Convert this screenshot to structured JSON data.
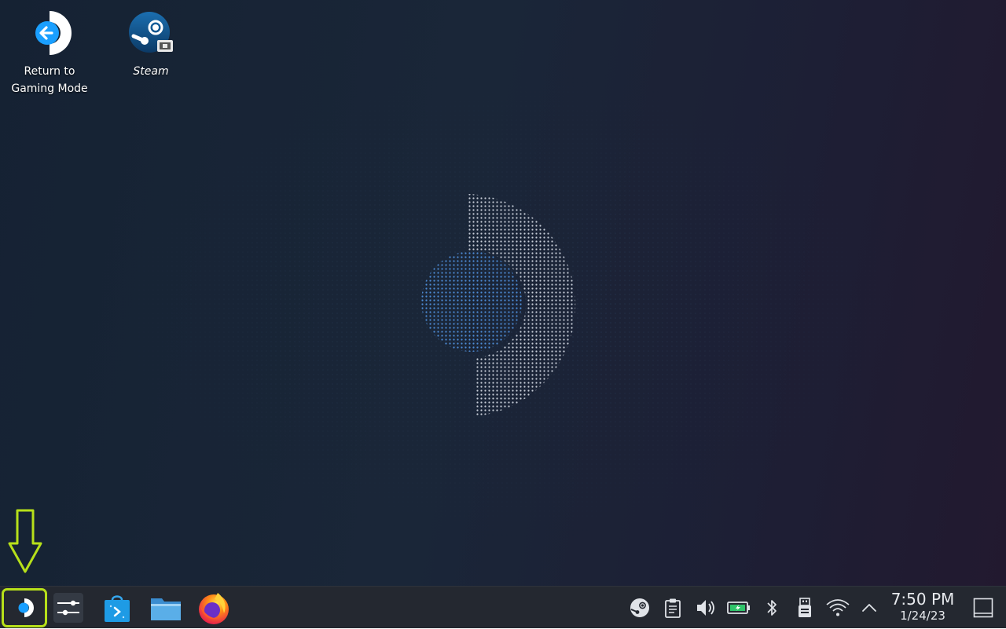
{
  "desktop": {
    "icons": [
      {
        "label": "Return to Gaming Mode",
        "icon": "return-arrow-icon"
      },
      {
        "label": "Steam",
        "icon": "steam-icon"
      }
    ]
  },
  "taskbar": {
    "apps": [
      {
        "name": "Application Launcher",
        "icon": "steam-deck-logo-icon"
      },
      {
        "name": "System Settings",
        "icon": "settings-sliders-icon"
      },
      {
        "name": "Discover",
        "icon": "store-bag-icon"
      },
      {
        "name": "Dolphin",
        "icon": "folder-icon"
      },
      {
        "name": "Firefox",
        "icon": "firefox-icon"
      }
    ],
    "tray": [
      "steam-icon",
      "clipboard-icon",
      "volume-icon",
      "battery-icon",
      "bluetooth-icon",
      "usb-icon",
      "wifi-icon",
      "chevron-up-icon"
    ],
    "clock": {
      "time": "7:50 PM",
      "date": "1/24/23"
    }
  },
  "colors": {
    "highlight": "#b7e01a",
    "deck_blue": "#1a9fff",
    "taskbar": "#242830"
  }
}
